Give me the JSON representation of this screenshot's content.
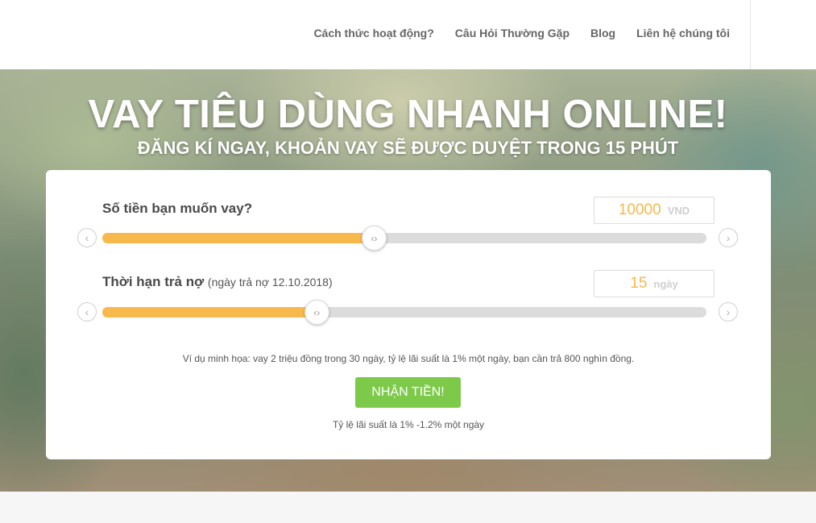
{
  "nav": {
    "items": [
      {
        "label": "Cách thức hoạt động?"
      },
      {
        "label": "Câu Hỏi Thường Gặp"
      },
      {
        "label": "Blog"
      },
      {
        "label": "Liên hệ chúng tôi"
      }
    ]
  },
  "hero": {
    "title": "VAY TIÊU DÙNG NHANH ONLINE!",
    "subtitle": "ĐĂNG KÍ NGAY, KHOẢN VAY SẼ ĐƯỢC DUYỆT TRONG 15 PHÚT"
  },
  "calculator": {
    "amount": {
      "label": "Số tiền bạn muốn vay?",
      "value": "10000",
      "unit": "VND",
      "slider_fraction": 0.45
    },
    "term": {
      "label": "Thời hạn trả nợ",
      "hint": "(ngày trả nợ 12.10.2018)",
      "value": "15",
      "unit": "ngày",
      "slider_fraction": 0.355
    },
    "example_text": "Ví dụ minh họa: vay 2 triệu đồng trong 30 ngày, tỷ lệ lãi suất là 1% một ngày, bạn cần trả 800 nghìn đồng.",
    "cta_label": "NHẬN TIỀN!",
    "rate_text": "Tỷ lệ lãi suất là 1% -1.2% một ngày"
  },
  "colors": {
    "accent": "#f8b94c",
    "cta": "#7dc94a",
    "track": "#dcdcdc"
  },
  "icons": {
    "handle": "chevrons-left-right-icon",
    "prev": "chevron-left-icon",
    "next": "chevron-right-icon"
  }
}
